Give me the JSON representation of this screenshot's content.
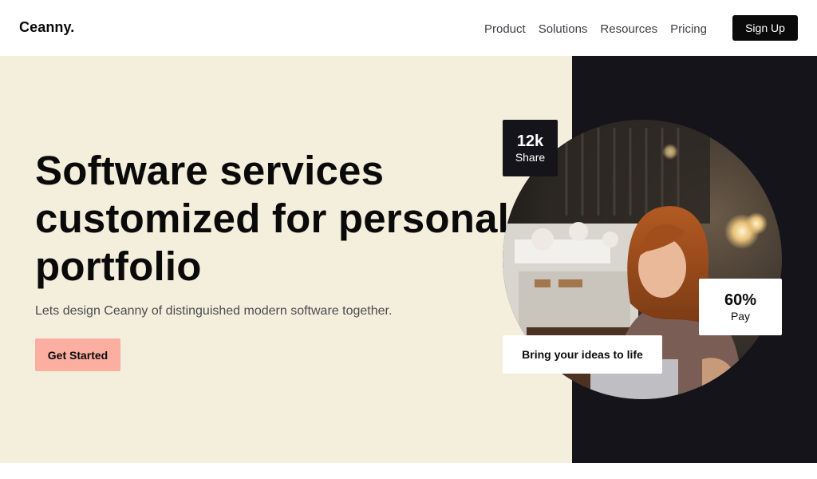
{
  "brand": {
    "logo": "Ceanny."
  },
  "nav": {
    "links": [
      "Product",
      "Solutions",
      "Resources",
      "Pricing"
    ],
    "signup_label": "Sign Up"
  },
  "hero": {
    "headline_lines": [
      "Software services",
      "customized for personal",
      "portfolio"
    ],
    "subtext": "Lets design Ceanny of distinguished modern software together.",
    "cta_label": "Get Started"
  },
  "stats": {
    "share": {
      "value": "12k",
      "label": "Share"
    },
    "pay": {
      "value": "60%",
      "label": "Pay"
    }
  },
  "callout": {
    "text": "Bring your ideas to life"
  },
  "colors": {
    "hero_left_bg": "#f4efdc",
    "hero_right_bg": "#15141a",
    "cta_bg": "#fcaea0",
    "signup_bg": "#0a0a0a"
  }
}
